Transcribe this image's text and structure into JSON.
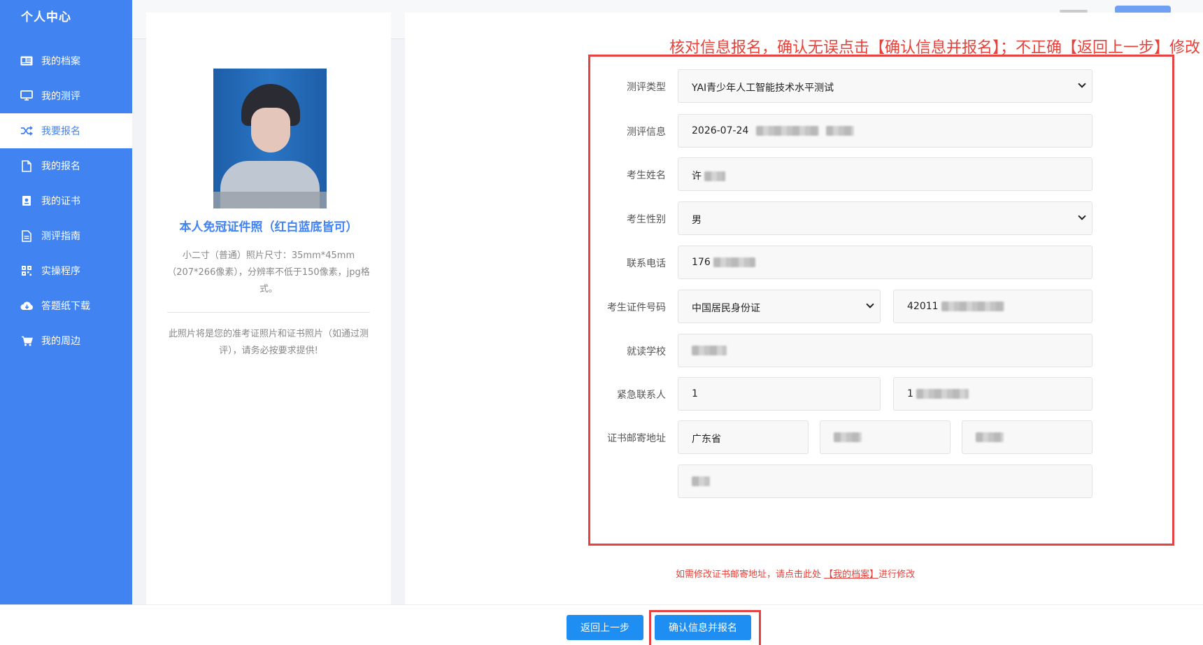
{
  "sidebar": {
    "title": "个人中心",
    "items": [
      {
        "label": "我的档案",
        "icon": "id-card-icon"
      },
      {
        "label": "我的测评",
        "icon": "monitor-icon"
      },
      {
        "label": "我要报名",
        "icon": "shuffle-icon",
        "active": true
      },
      {
        "label": "我的报名",
        "icon": "document-icon"
      },
      {
        "label": "我的证书",
        "icon": "certificate-icon"
      },
      {
        "label": "测评指南",
        "icon": "guide-icon"
      },
      {
        "label": "实操程序",
        "icon": "grid-icon"
      },
      {
        "label": "答题纸下载",
        "icon": "cloud-download-icon"
      },
      {
        "label": "我的周边",
        "icon": "cart-icon"
      }
    ]
  },
  "photo_card": {
    "title": "本人免冠证件照（红白蓝底皆可）",
    "description": "小二寸（普通）照片尺寸：35mm*45mm（207*266像素），分辨率不低于150像素，jpg格式。",
    "note": "此照片将是您的准考证照片和证书照片（如通过测评），请务必按要求提供!"
  },
  "instruction": "核对信息报名，确认无误点击【确认信息并报名】；不正确【返回上一步】修改",
  "form": {
    "assessment_type": {
      "label": "测评类型",
      "value": "YAI青少年人工智能技术水平测试"
    },
    "assessment_info": {
      "label": "测评信息",
      "value": "2026-07-24"
    },
    "name": {
      "label": "考生姓名",
      "value": "许"
    },
    "gender": {
      "label": "考生性别",
      "value": "男"
    },
    "phone": {
      "label": "联系电话",
      "value": "176"
    },
    "id": {
      "label": "考生证件号码",
      "type": "中国居民身份证",
      "number": "42011"
    },
    "school": {
      "label": "就读学校",
      "value": ""
    },
    "emergency": {
      "label": "紧急联系人",
      "name": "1",
      "phone": "1"
    },
    "address": {
      "label": "证书邮寄地址",
      "province": "广东省",
      "city": "",
      "district": "",
      "detail": ""
    }
  },
  "hint": {
    "prefix": "如需修改证书邮寄地址，请点击此处 ",
    "link": "【我的档案】",
    "suffix": "进行修改"
  },
  "buttons": {
    "back": "返回上一步",
    "confirm": "确认信息并报名"
  },
  "colors": {
    "primary": "#4283f2",
    "button": "#1e8ef3",
    "alert": "#e54343"
  }
}
